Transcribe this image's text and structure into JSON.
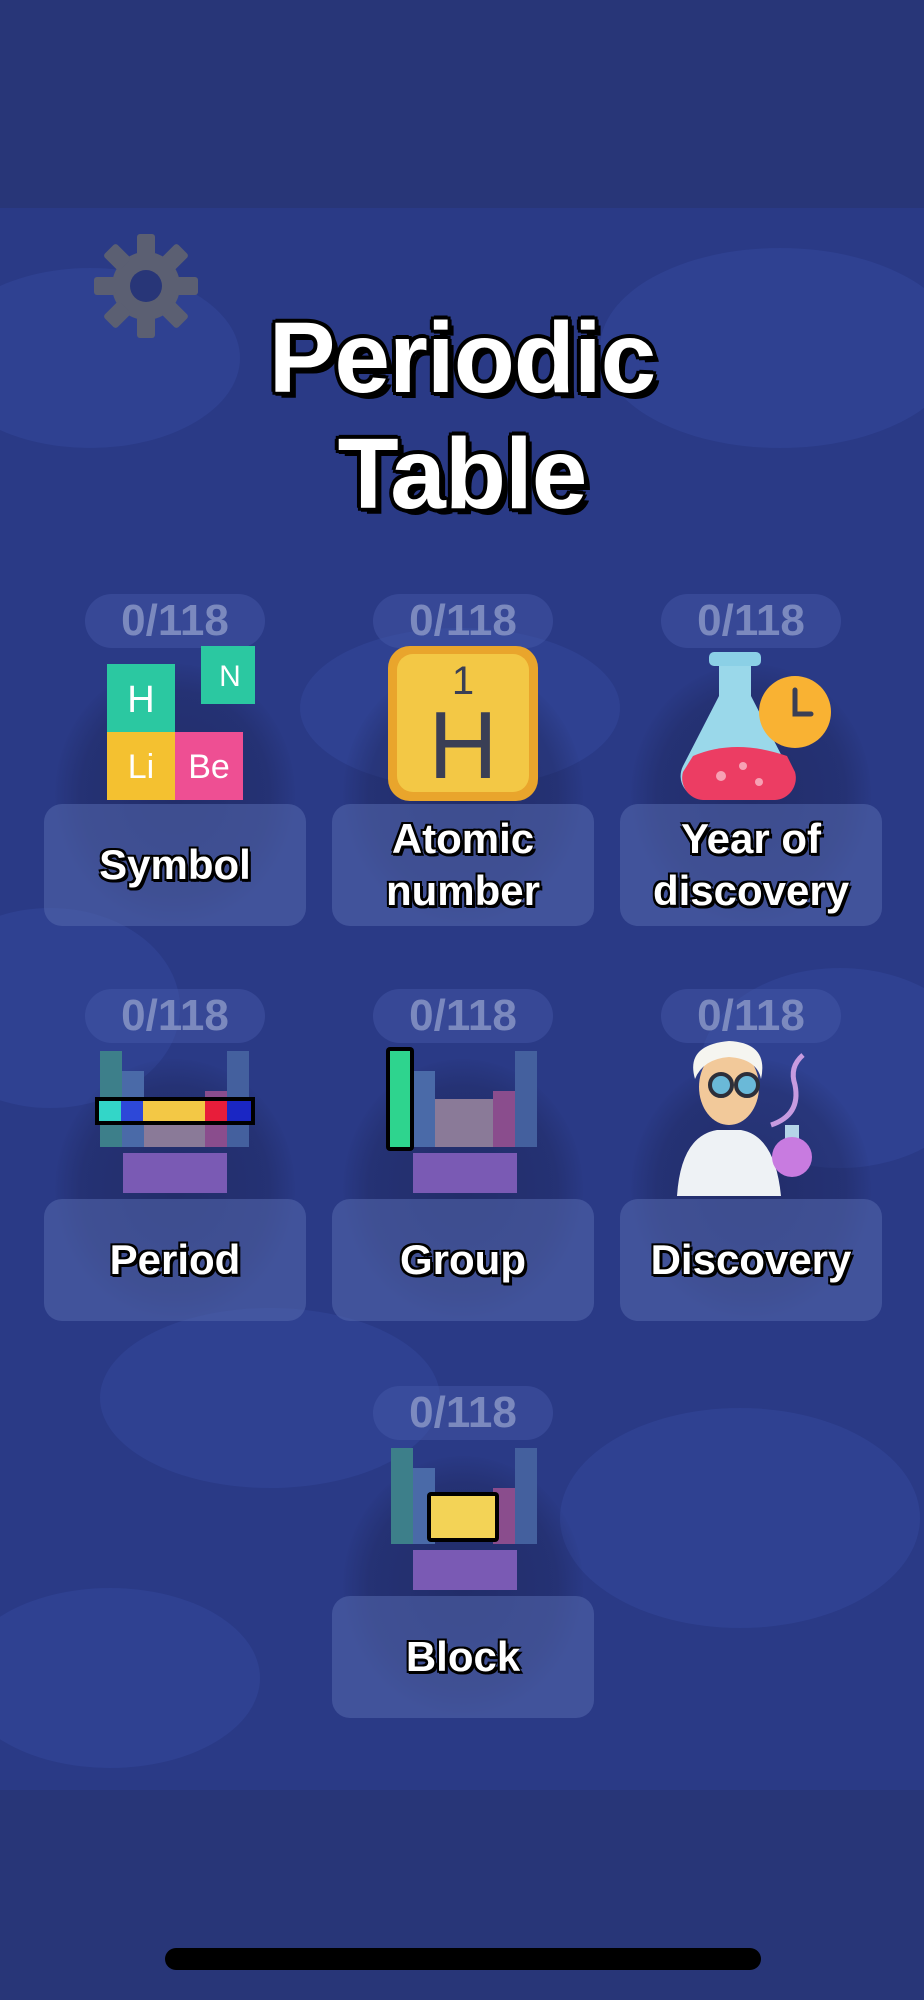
{
  "title": {
    "line1": "Periodic",
    "line2": "Table"
  },
  "settings": {
    "icon": "gear-icon"
  },
  "modes": [
    {
      "id": "symbol",
      "progress": "0/118",
      "label": "Symbol",
      "icon": "element-tiles-icon"
    },
    {
      "id": "atomic-number",
      "progress": "0/118",
      "label": "Atomic\nnumber",
      "icon": "hydrogen-tile-icon"
    },
    {
      "id": "year-of-discovery",
      "progress": "0/118",
      "label": "Year of\ndiscovery",
      "icon": "flask-clock-icon"
    },
    {
      "id": "period",
      "progress": "0/118",
      "label": "Period",
      "icon": "period-row-icon"
    },
    {
      "id": "group",
      "progress": "0/118",
      "label": "Group",
      "icon": "group-column-icon"
    },
    {
      "id": "discovery",
      "progress": "0/118",
      "label": "Discovery",
      "icon": "scientist-icon"
    },
    {
      "id": "block",
      "progress": "0/118",
      "label": "Block",
      "icon": "block-icon"
    }
  ],
  "icon_text": {
    "h": "H",
    "n": "N",
    "li": "Li",
    "be": "Be",
    "one": "1"
  },
  "colors": {
    "background": "#283678",
    "card": "#5265aa",
    "accent_yellow": "#f0c341"
  }
}
